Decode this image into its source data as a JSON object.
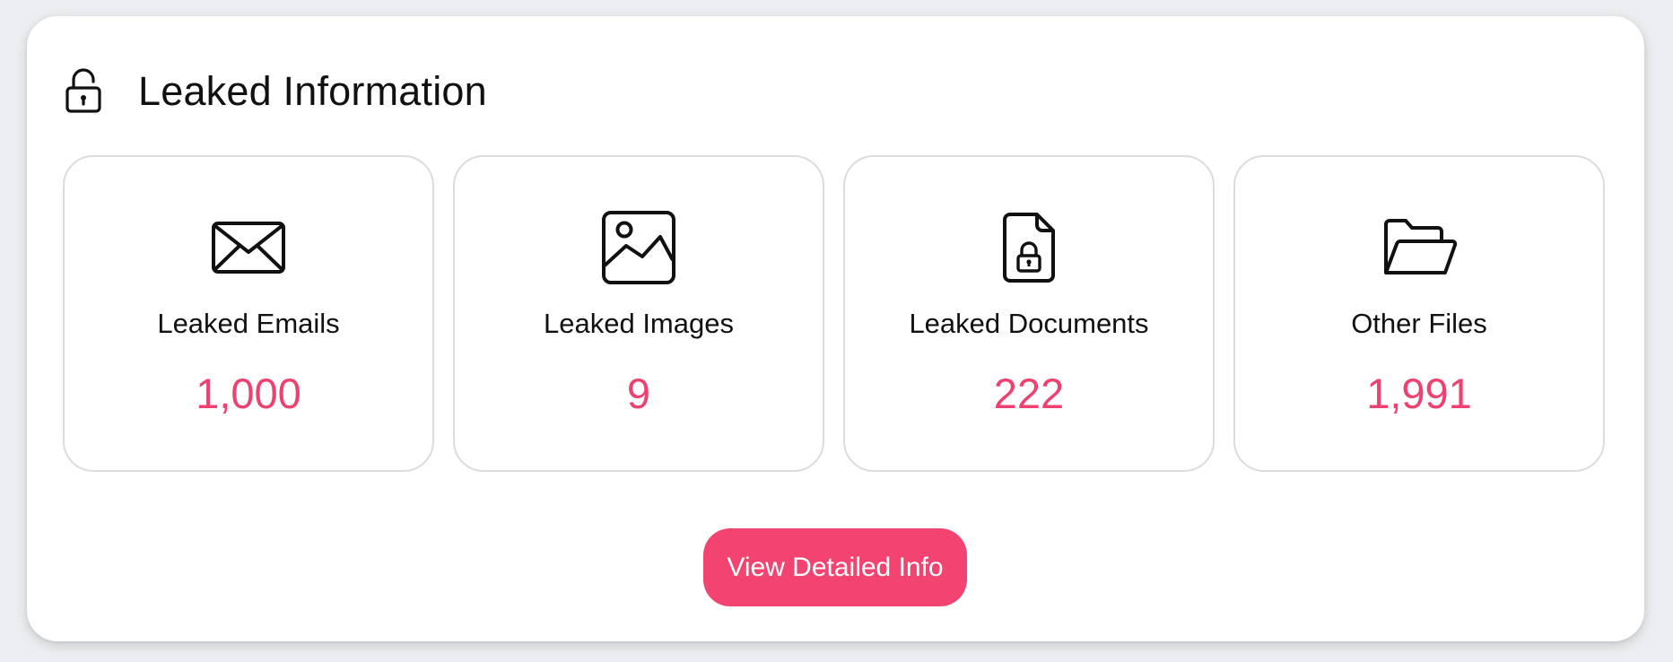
{
  "colors": {
    "accent": "#f24371",
    "value_text": "#ef416f"
  },
  "header": {
    "icon": "unlocked-padlock-icon",
    "title": "Leaked Information"
  },
  "cards": [
    {
      "icon": "envelope-icon",
      "label": "Leaked Emails",
      "value": "1,000"
    },
    {
      "icon": "image-icon",
      "label": "Leaked Images",
      "value": "9"
    },
    {
      "icon": "locked-document-icon",
      "label": "Leaked Documents",
      "value": "222"
    },
    {
      "icon": "open-folder-icon",
      "label": "Other Files",
      "value": "1,991"
    }
  ],
  "actions": {
    "detail_button_label": "View Detailed Info"
  }
}
